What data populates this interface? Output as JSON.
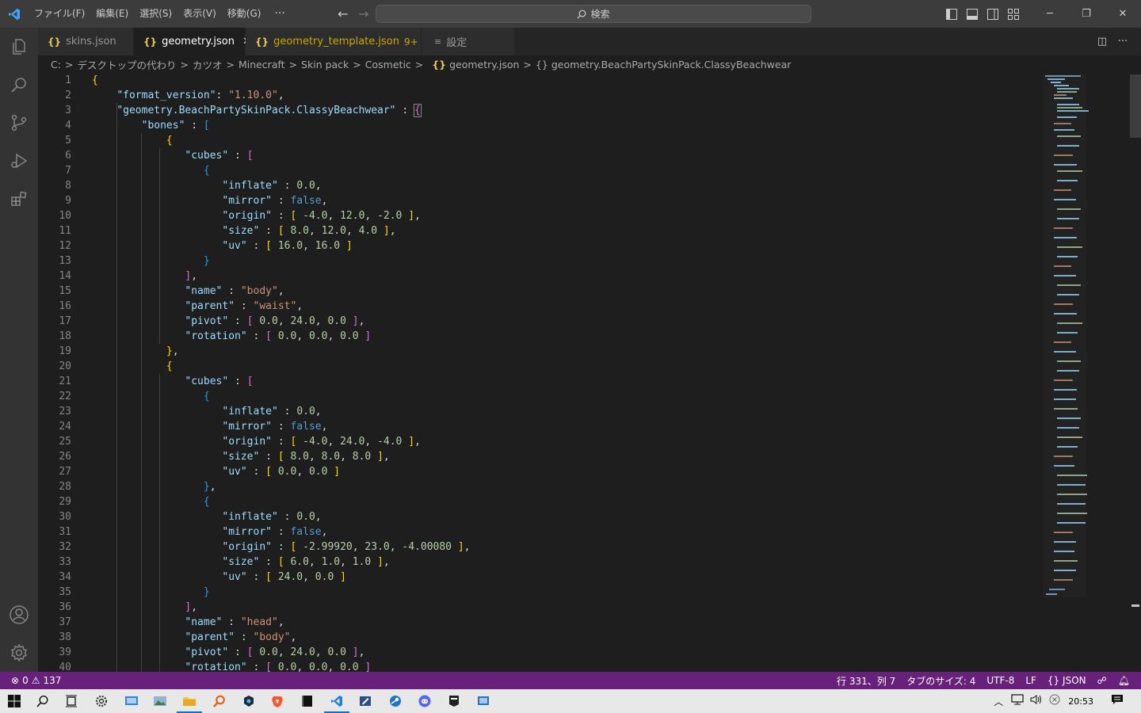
{
  "titlebar": {
    "menus": [
      "ファイル(F)",
      "編集(E)",
      "選択(S)",
      "表示(V)",
      "移動(G)"
    ],
    "more": "···",
    "search_label": "検索"
  },
  "tabs": [
    {
      "label": "skins.json",
      "active": false
    },
    {
      "label": "geometry.json",
      "active": true
    },
    {
      "label": "geometry_template.json",
      "badge": "9+",
      "modified": true
    },
    {
      "label": "設定",
      "active": false
    }
  ],
  "breadcrumb": [
    "C:",
    "デスクトップの代わり",
    "カツオ",
    "Minecraft",
    "Skin pack",
    "Cosmetic",
    "geometry.json",
    "geometry.BeachPartySkinPack.ClassyBeachwear"
  ],
  "code_lines": [
    "1",
    "2",
    "3",
    "4",
    "5",
    "6",
    "7",
    "8",
    "9",
    "10",
    "11",
    "12",
    "13",
    "14",
    "15",
    "16",
    "17",
    "18",
    "19",
    "20",
    "21",
    "22",
    "23",
    "24",
    "25",
    "26",
    "27",
    "28",
    "29",
    "30",
    "31",
    "32",
    "33",
    "34",
    "35",
    "36",
    "37",
    "38",
    "39",
    "40"
  ],
  "code": {
    "format_version_key": "\"format_version\"",
    "format_version_val": "\"1.10.0\"",
    "geometry_key": "\"geometry.BeachPartySkinPack.ClassyBeachwear\"",
    "bones": "\"bones\"",
    "cubes": "\"cubes\"",
    "inflate": "\"inflate\"",
    "mirror": "\"mirror\"",
    "origin": "\"origin\"",
    "size": "\"size\"",
    "uv": "\"uv\"",
    "name": "\"name\"",
    "parent": "\"parent\"",
    "pivot": "\"pivot\"",
    "rotation": "\"rotation\"",
    "body": "\"body\"",
    "waist": "\"waist\"",
    "head": "\"head\"",
    "false": "false"
  },
  "status": {
    "errors": "0",
    "warnings": "137",
    "position": "行 331、列 7",
    "tab_size": "タブのサイズ: 4",
    "encoding": "UTF-8",
    "eol": "LF",
    "language": "JSON"
  },
  "taskbar": {
    "clock": "20:53"
  },
  "colors": {
    "statusbar": "#68217a",
    "titlebar": "#3c3c3c",
    "editor_bg": "#1e1e1e",
    "activitybar": "#333333"
  }
}
